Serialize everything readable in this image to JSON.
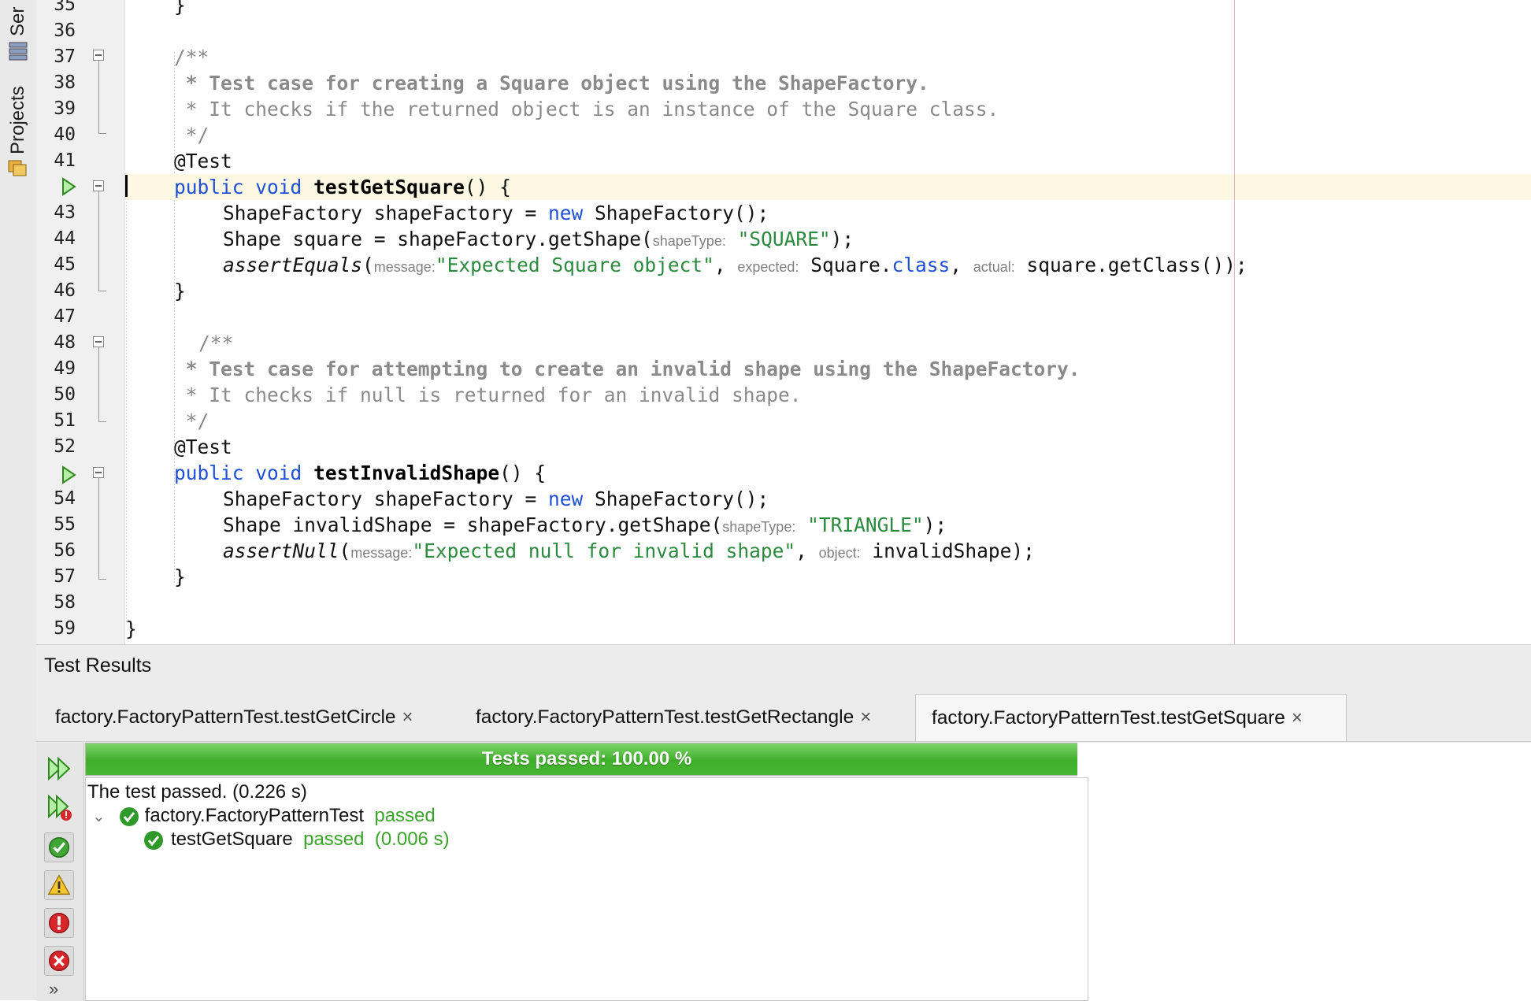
{
  "sidebar": {
    "tabs": [
      {
        "label": "Ser"
      },
      {
        "label": "Projects"
      }
    ]
  },
  "editor": {
    "line_numbers": [
      "35",
      "36",
      "37",
      "38",
      "39",
      "40",
      "41",
      "",
      "43",
      "44",
      "45",
      "46",
      "47",
      "48",
      "49",
      "50",
      "51",
      "52",
      "",
      "54",
      "55",
      "56",
      "57",
      "58",
      "59"
    ],
    "code": {
      "l35": "}",
      "l37": "/**",
      "l38": " * Test case for creating a Square object using the ShapeFactory.",
      "l39": " * It checks if the returned object is an instance of the Square class.",
      "l40": " */",
      "l41": "@Test",
      "l42_kw1": "public",
      "l42_kw2": "void",
      "l42_fn": "testGetSquare",
      "l42_rest": "() {",
      "l43_a": "ShapeFactory shapeFactory = ",
      "l43_kw": "new",
      "l43_b": " ShapeFactory();",
      "l44_a": "Shape square = shapeFactory.getShape(",
      "l44_hint": "shapeType:",
      "l44_str": "\"SQUARE\"",
      "l44_b": ");",
      "l45_fn": "assertEquals",
      "l45_a": "(",
      "l45_hint1": "message:",
      "l45_str": "\"Expected Square object\"",
      "l45_b": ", ",
      "l45_hint2": "expected:",
      "l45_c": "Square.",
      "l45_kw": "class",
      "l45_d": ", ",
      "l45_hint3": "actual:",
      "l45_e": "square.getClass());",
      "l46": "}",
      "l48": "/**",
      "l49": " * Test case for attempting to create an invalid shape using the ShapeFactory.",
      "l50": " * It checks if null is returned for an invalid shape.",
      "l51": " */",
      "l52": "@Test",
      "l53_kw1": "public",
      "l53_kw2": "void",
      "l53_fn": "testInvalidShape",
      "l53_rest": "() {",
      "l54_a": "ShapeFactory shapeFactory = ",
      "l54_kw": "new",
      "l54_b": " ShapeFactory();",
      "l55_a": "Shape invalidShape = shapeFactory.getShape(",
      "l55_hint": "shapeType:",
      "l55_str": "\"TRIANGLE\"",
      "l55_b": ");",
      "l56_fn": "assertNull",
      "l56_a": "(",
      "l56_hint1": "message:",
      "l56_str": "\"Expected null for invalid shape\"",
      "l56_b": ", ",
      "l56_hint2": "object:",
      "l56_c": "invalidShape);",
      "l57": "}",
      "l59": "}"
    }
  },
  "test_results": {
    "title": "Test Results",
    "tabs": [
      {
        "label": "factory.FactoryPatternTest.testGetCircle",
        "close": "×"
      },
      {
        "label": "factory.FactoryPatternTest.testGetRectangle",
        "close": "×"
      },
      {
        "label": "factory.FactoryPatternTest.testGetSquare",
        "close": "×"
      }
    ],
    "active_tab": 2,
    "progress": {
      "label": "Tests passed: 100.00 %",
      "fraction": 1.0
    },
    "summary": "The test passed. (0.226 s)",
    "tree": {
      "suite": {
        "name": "factory.FactoryPatternTest",
        "status": "passed"
      },
      "tests": [
        {
          "name": "testGetSquare",
          "status": "passed",
          "time": "(0.006 s)"
        }
      ]
    },
    "toolbar_icons": [
      "rerun-icon",
      "rerun-failed-icon",
      "show-passed-icon",
      "show-warnings-icon",
      "show-errors-icon",
      "show-failures-icon",
      "more-icon"
    ],
    "more_label": "»"
  },
  "colors": {
    "keyword": "#1f4fd6",
    "string": "#2b8a3e",
    "comment": "#8a8a8a",
    "pass_green": "#3aa52a",
    "progress_green": "#48b833",
    "current_line": "#fcf8e2"
  }
}
